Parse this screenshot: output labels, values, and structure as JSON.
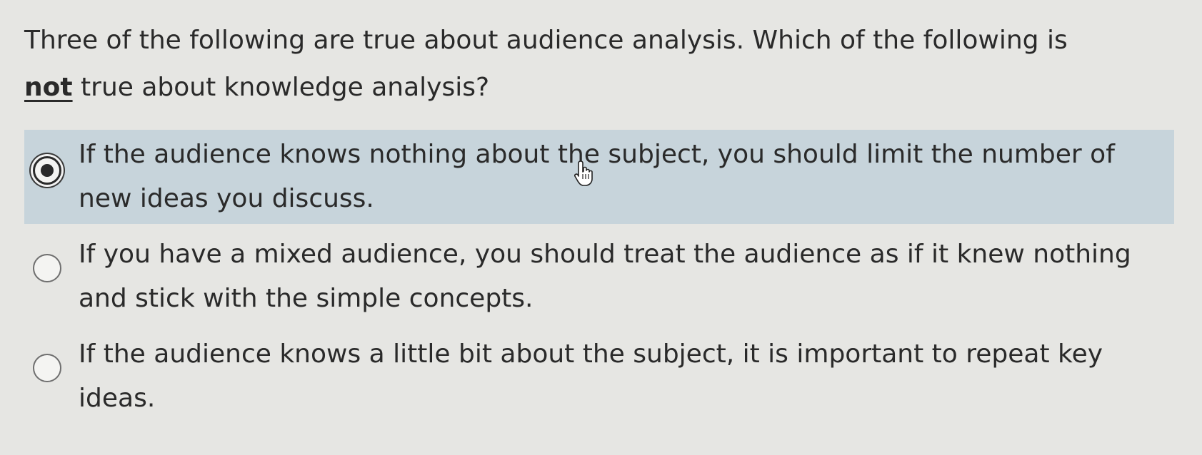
{
  "question": {
    "line1": "Three of the following are true about audience analysis. Which of the following is",
    "emphasis": "not",
    "line2_rest": " true about knowledge analysis?"
  },
  "options": [
    {
      "text": "If the audience knows nothing about the subject, you should limit the number of new ideas you discuss.",
      "selected": true
    },
    {
      "text": "If you have a mixed audience, you should treat the audience as if it knew nothing and stick with the simple concepts.",
      "selected": false
    },
    {
      "text": "If the audience knows a little bit about the subject, it is important to repeat key ideas.",
      "selected": false
    }
  ],
  "colors": {
    "background": "#e6e6e3",
    "selected_option_bg": "#c7d4db",
    "text": "#2a2a2a"
  },
  "icons": {
    "cursor": "hand-pointer-icon"
  }
}
